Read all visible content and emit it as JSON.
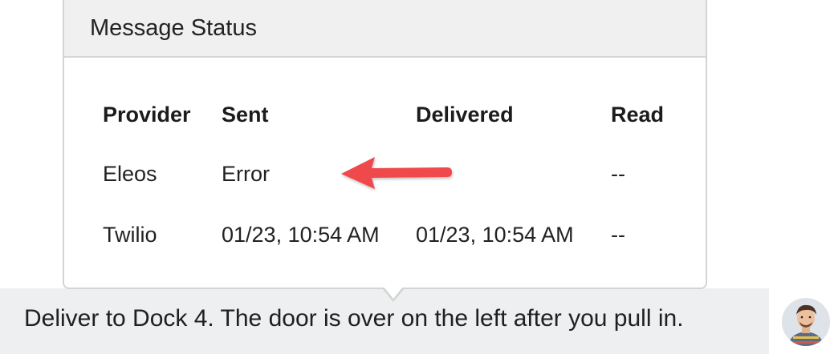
{
  "popover": {
    "title": "Message Status",
    "columns": [
      "Provider",
      "Sent",
      "Delivered",
      "Read"
    ],
    "rows": [
      {
        "provider": "Eleos",
        "sent": "Error",
        "delivered": "--",
        "read": "--"
      },
      {
        "provider": "Twilio",
        "sent": "01/23, 10:54 AM",
        "delivered": "01/23, 10:54 AM",
        "read": "--"
      }
    ]
  },
  "message": {
    "text": "Deliver to Dock 4. The door is over on the left after you pull in."
  },
  "annotation": {
    "arrow_color": "#f0484b",
    "arrow_icon": "left-arrow-annotation"
  },
  "avatar": {
    "icon": "user-avatar"
  }
}
